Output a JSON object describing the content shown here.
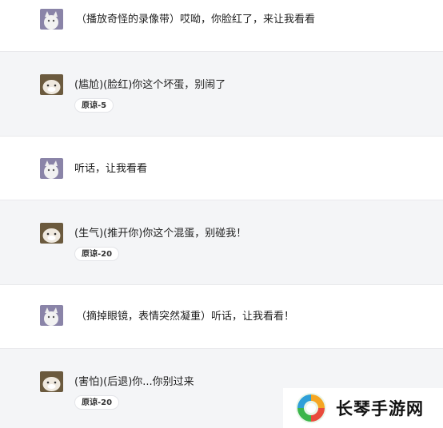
{
  "conversation": [
    {
      "role": "user",
      "text": "（播放奇怪的录像带）哎呦，你脸红了，来让我看看"
    },
    {
      "role": "bot",
      "text": "(尴尬)(脸红)你这个坏蛋，别闹了",
      "badge": "原谅-5"
    },
    {
      "role": "user",
      "text": "听话，让我看看"
    },
    {
      "role": "bot",
      "text": "(生气)(推开你)你这个混蛋，别碰我！",
      "badge": "原谅-20"
    },
    {
      "role": "user",
      "text": "（摘掉眼镜，表情突然凝重）听话，让我看看！"
    },
    {
      "role": "bot",
      "text": "(害怕)(后退)你...你别过来",
      "badge": "原谅-20"
    }
  ],
  "watermark": {
    "text": "长琴手游网",
    "logo_icon": "swirl-logo-icon"
  },
  "colors": {
    "user_row": "#ffffff",
    "bot_row": "#f4f5f7",
    "text": "#1f1f1f"
  }
}
